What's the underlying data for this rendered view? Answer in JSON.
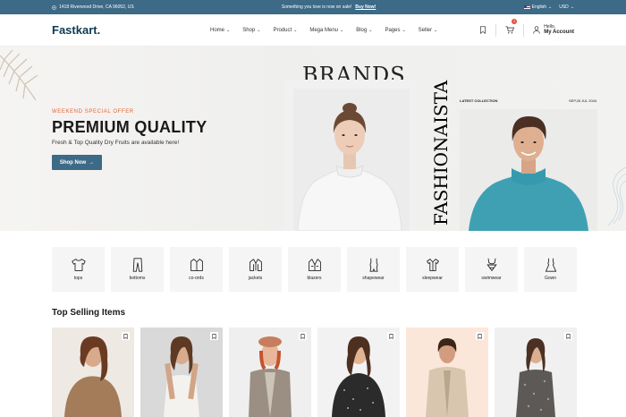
{
  "topbar": {
    "address": "1418 Riverwood Drive, CA 96052, US",
    "promo": "Something you love is now on sale!",
    "promo_link": "Buy Now!",
    "language": "English",
    "currency": "USD"
  },
  "header": {
    "logo": "Fastkart",
    "logo_dot": ".",
    "nav": [
      "Home",
      "Shop",
      "Product",
      "Mega Menu",
      "Blog",
      "Pages",
      "Seller"
    ],
    "cart_count": "2",
    "account_greeting": "Hello,",
    "account_label": "My Account"
  },
  "hero": {
    "kicker": "WEEKEND SPECIAL OFFER",
    "title": "PREMIUM QUALITY",
    "subtitle": "Fresh & Top Quality Dry Fruits are available here!",
    "button": "Shop Now",
    "brands": "BRANDS",
    "vertical_text": "FASHIONAISTA",
    "latest": "LATEST COLLECTION",
    "date": "SEP,26 JUL 2044"
  },
  "categories": [
    {
      "label": "tops",
      "icon": "tshirt-icon"
    },
    {
      "label": "bottoms",
      "icon": "pants-icon"
    },
    {
      "label": "co-ords",
      "icon": "coords-icon"
    },
    {
      "label": "jackets",
      "icon": "jacket-icon"
    },
    {
      "label": "blazers",
      "icon": "blazer-icon"
    },
    {
      "label": "shapewear",
      "icon": "shapewear-icon"
    },
    {
      "label": "sleepwear",
      "icon": "sleepwear-icon"
    },
    {
      "label": "swimwear",
      "icon": "swimwear-icon"
    },
    {
      "label": "Gown",
      "icon": "gown-icon"
    }
  ],
  "section": {
    "top_selling": "Top Selling Items"
  },
  "colors": {
    "primary": "#3d6a86",
    "accent": "#e0673a",
    "badge": "#e74c3c"
  }
}
